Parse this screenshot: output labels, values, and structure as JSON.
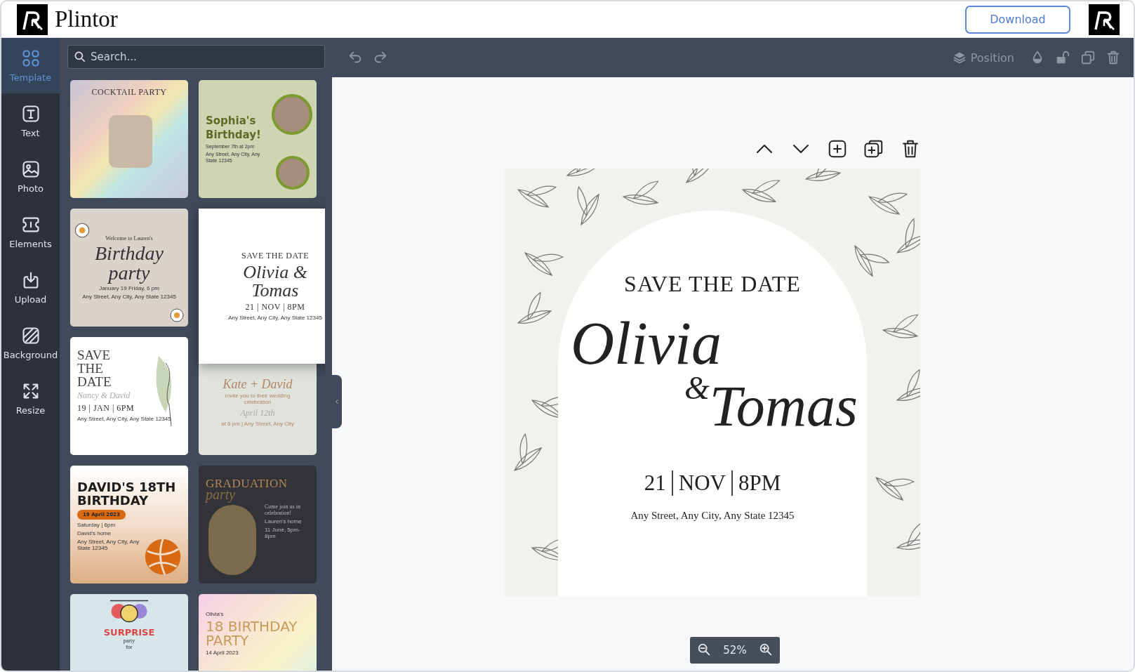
{
  "app": {
    "brand": "Plintor",
    "download": "Download"
  },
  "sidebar": [
    {
      "kind": "grid",
      "label": "Template",
      "selected": true
    },
    {
      "kind": "text",
      "label": "Text",
      "selected": false
    },
    {
      "kind": "photo",
      "label": "Photo",
      "selected": false
    },
    {
      "kind": "elements",
      "label": "Elements",
      "selected": false
    },
    {
      "kind": "upload",
      "label": "Upload",
      "selected": false
    },
    {
      "kind": "background",
      "label": "Background",
      "selected": false
    },
    {
      "kind": "resize",
      "label": "Resize",
      "selected": false
    }
  ],
  "search": {
    "placeholder": "Search..."
  },
  "toolbar": {
    "position": "Position"
  },
  "templates": [
    {
      "kind": "cocktail",
      "dragging": false,
      "texts": [
        "COCKTAIL PARTY"
      ]
    },
    {
      "kind": "sophia",
      "dragging": false,
      "texts": [
        "Sophia's Birthday!",
        "September 7th at 2pm",
        "Any Street, Any City, Any State 12345"
      ]
    },
    {
      "kind": "flowers",
      "dragging": false,
      "texts": [
        "Welcome to Lauren's",
        "Birthday party",
        "January 19 Friday, 6 pm",
        "Any Street, Any City, Any State 12345"
      ]
    },
    {
      "kind": "leaves",
      "dragging": true,
      "texts": [
        "SAVE THE DATE",
        "Olivia & Tomas",
        "21 | NOV | 8PM",
        "Any Street, Any City, Any State 12345"
      ]
    },
    {
      "kind": "nancy",
      "dragging": false,
      "texts": [
        "SAVE THE DATE",
        "Nancy & David",
        "19 | JAN | 6PM",
        "Any Street, Any City, Any State 12345"
      ]
    },
    {
      "kind": "wreath",
      "dragging": false,
      "texts": [
        "Kate + David",
        "Invite you to their wedding celebration",
        "April 12th",
        "at 6 pm | Any Street, Any City"
      ]
    },
    {
      "kind": "ball",
      "dragging": false,
      "texts": [
        "DAVID'S 18TH BIRTHDAY",
        "19 April 2023",
        "Saturday | 6pm",
        "David's home",
        "Any Street, Any City, Any State 12345"
      ]
    },
    {
      "kind": "graduation",
      "dragging": false,
      "texts": [
        "GRADUATION",
        "party",
        "Come join us in celebration!",
        "Lauren's home",
        "11 June, 5pm-8pm"
      ]
    },
    {
      "kind": "surprise",
      "dragging": false,
      "texts": [
        "SURPRISE",
        "party",
        "for"
      ]
    },
    {
      "kind": "pastel",
      "dragging": false,
      "texts": [
        "Olivia's",
        "18 BIRTHDAY PARTY",
        "14 April 2023"
      ]
    }
  ],
  "design": {
    "heading": "SAVE THE DATE",
    "first_name": "Olivia",
    "ampersand": "&",
    "second_name": "Tomas",
    "day": "21",
    "month": "NOV",
    "time": "8PM",
    "address": "Any Street, Any City, Any State 12345"
  },
  "zoom": {
    "value": "52%"
  }
}
